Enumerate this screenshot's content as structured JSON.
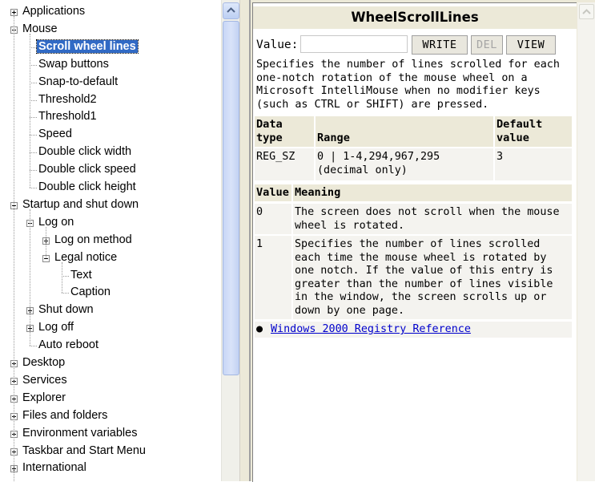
{
  "tree": {
    "items": [
      {
        "label": "Applications",
        "level": 0,
        "toggle": "plus"
      },
      {
        "label": "Mouse",
        "level": 0,
        "toggle": "minus"
      },
      {
        "label": "Scroll wheel lines",
        "level": 1,
        "toggle": "none",
        "selected": true
      },
      {
        "label": "Swap buttons",
        "level": 1,
        "toggle": "none"
      },
      {
        "label": "Snap-to-default",
        "level": 1,
        "toggle": "none"
      },
      {
        "label": "Threshold2",
        "level": 1,
        "toggle": "none"
      },
      {
        "label": "Threshold1",
        "level": 1,
        "toggle": "none"
      },
      {
        "label": "Speed",
        "level": 1,
        "toggle": "none"
      },
      {
        "label": "Double click width",
        "level": 1,
        "toggle": "none"
      },
      {
        "label": "Double click speed",
        "level": 1,
        "toggle": "none"
      },
      {
        "label": "Double click height",
        "level": 1,
        "toggle": "none"
      },
      {
        "label": "Startup and shut down",
        "level": 0,
        "toggle": "minus"
      },
      {
        "label": "Log on",
        "level": 1,
        "toggle": "minus"
      },
      {
        "label": "Log on method",
        "level": 2,
        "toggle": "plus"
      },
      {
        "label": "Legal notice",
        "level": 2,
        "toggle": "minus"
      },
      {
        "label": "Text",
        "level": 3,
        "toggle": "none"
      },
      {
        "label": "Caption",
        "level": 3,
        "toggle": "none"
      },
      {
        "label": "Shut down",
        "level": 1,
        "toggle": "plus"
      },
      {
        "label": "Log off",
        "level": 1,
        "toggle": "plus"
      },
      {
        "label": "Auto reboot",
        "level": 1,
        "toggle": "none"
      },
      {
        "label": "Desktop",
        "level": 0,
        "toggle": "plus"
      },
      {
        "label": "Services",
        "level": 0,
        "toggle": "plus"
      },
      {
        "label": "Explorer",
        "level": 0,
        "toggle": "plus"
      },
      {
        "label": "Files and folders",
        "level": 0,
        "toggle": "plus"
      },
      {
        "label": "Environment variables",
        "level": 0,
        "toggle": "plus"
      },
      {
        "label": "Taskbar and Start Menu",
        "level": 0,
        "toggle": "plus"
      },
      {
        "label": "International",
        "level": 0,
        "toggle": "plus"
      }
    ]
  },
  "content": {
    "title": "WheelScrollLines",
    "value_label": "Value:",
    "value_input": "",
    "buttons": {
      "write": "WRITE",
      "del": "DEL",
      "view": "VIEW"
    },
    "description": "Specifies the number of lines scrolled for each one-notch rotation of the mouse wheel on a Microsoft IntelliMouse when no modifier keys (such as CTRL or SHIFT) are pressed.",
    "info_table": {
      "headers": [
        "Data type",
        "Range",
        "Default value"
      ],
      "row": [
        "REG_SZ",
        "0 | 1-4,294,967,295 (decimal only)",
        "3"
      ]
    },
    "meaning_table": {
      "headers": [
        "Value",
        "Meaning"
      ],
      "rows": [
        {
          "value": "0",
          "meaning": "The screen does not scroll when the mouse wheel is rotated."
        },
        {
          "value": "1",
          "meaning": "Specifies the number of lines scrolled each time the mouse wheel is rotated by one notch. If the value of this entry is greater than the number of lines visible in the window, the screen scrolls up or down by one page."
        }
      ]
    },
    "reference_link": "Windows 2000 Registry Reference"
  },
  "icons": {
    "scroll_up": "chevron-up-icon",
    "bullet": "bullet-icon"
  },
  "colors": {
    "selection": "#316ac5",
    "header_bg": "#ece9d8",
    "link": "#0000cc"
  }
}
